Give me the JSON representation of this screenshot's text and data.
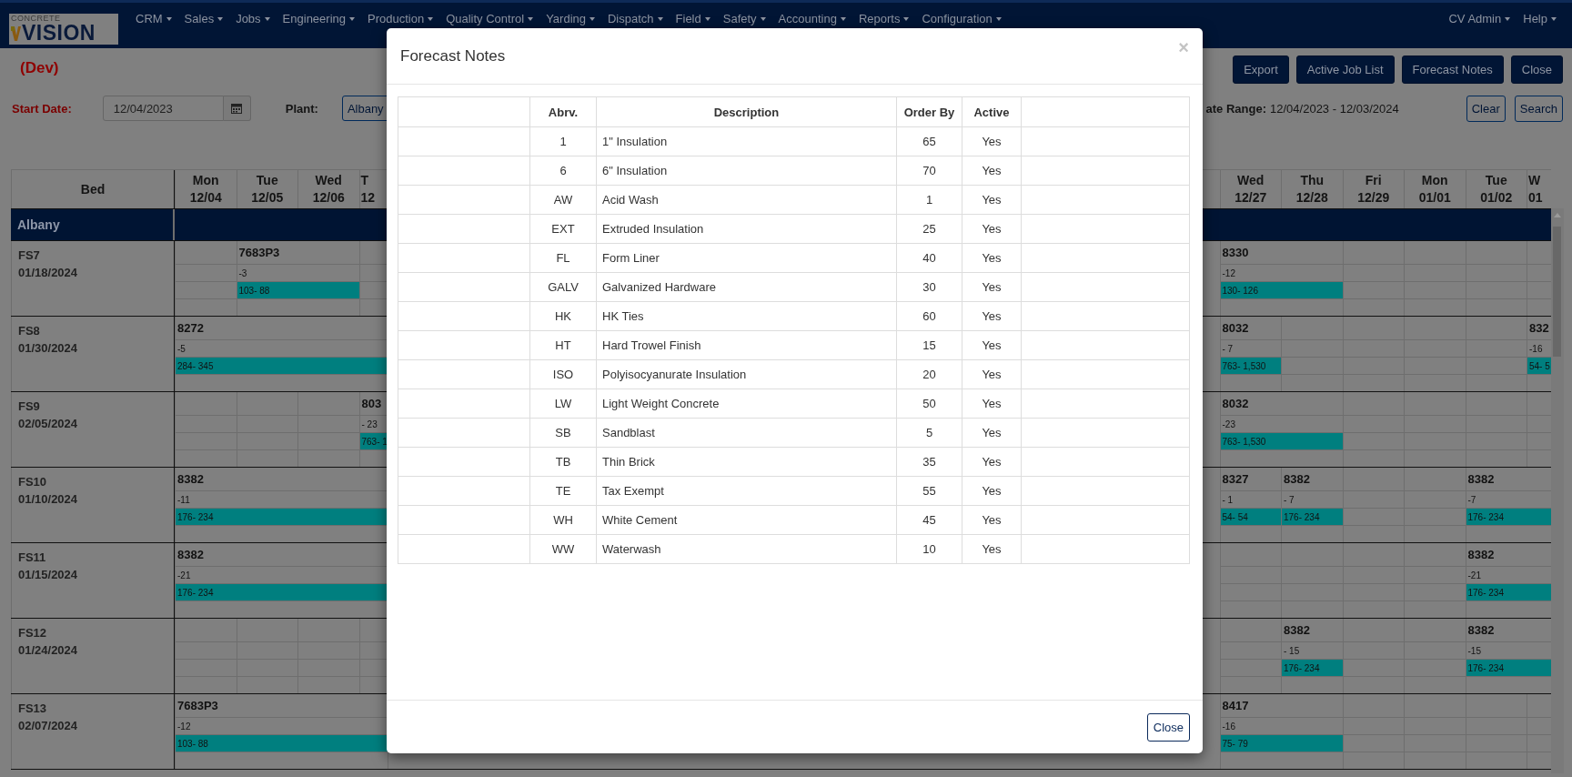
{
  "nav": {
    "logo": {
      "top": "CONCRETE",
      "main": "VISION"
    },
    "menu": [
      {
        "label": "CRM"
      },
      {
        "label": "Sales"
      },
      {
        "label": "Jobs"
      },
      {
        "label": "Engineering"
      },
      {
        "label": "Production"
      },
      {
        "label": "Quality Control"
      },
      {
        "label": "Yarding"
      },
      {
        "label": "Dispatch"
      },
      {
        "label": "Field"
      },
      {
        "label": "Safety"
      },
      {
        "label": "Accounting"
      },
      {
        "label": "Reports"
      },
      {
        "label": "Configuration"
      }
    ],
    "user_menu": [
      {
        "label": "CV Admin"
      },
      {
        "label": "Help"
      }
    ]
  },
  "page": {
    "env_label": "(Dev)",
    "buttons": [
      "Export",
      "Active Job List",
      "Forecast Notes",
      "Close"
    ]
  },
  "filters": {
    "start_date": {
      "label": "Start Date:",
      "value": "12/04/2023"
    },
    "plant": {
      "label": "Plant:",
      "value": "Albany"
    },
    "date_range": {
      "label": "ate Range:",
      "value": "12/04/2023 - 12/03/2024"
    },
    "buttons": [
      "Clear",
      "Search"
    ]
  },
  "schedule": {
    "bed_header": "Bed",
    "columns_left": [
      {
        "day": "Mon",
        "date": "12/04"
      },
      {
        "day": "Tue",
        "date": "12/05"
      },
      {
        "day": "Wed",
        "date": "12/06"
      },
      {
        "day": "T",
        "date": "12"
      }
    ],
    "columns_right": [
      {
        "day": "Wed",
        "date": "12/27"
      },
      {
        "day": "Thu",
        "date": "12/28"
      },
      {
        "day": "Fri",
        "date": "12/29"
      },
      {
        "day": "Mon",
        "date": "01/01"
      },
      {
        "day": "Tue",
        "date": "01/02"
      },
      {
        "day": "W",
        "date": "01"
      }
    ],
    "group": "Albany",
    "beds": [
      {
        "name": "FS7",
        "date": "01/18/2024",
        "left": [
          {
            "kind": "empty"
          },
          {
            "kind": "start",
            "job": "7683P3",
            "count": "-3",
            "range": "103- 88"
          },
          {
            "kind": "continue"
          },
          {
            "kind": "empty"
          }
        ],
        "right": [
          {
            "kind": "start",
            "job": "8330",
            "count": "-12",
            "range": "130- 126"
          },
          {
            "kind": "continue"
          },
          {
            "kind": "empty"
          },
          {
            "kind": "empty"
          },
          {
            "kind": "empty"
          },
          {
            "kind": "empty"
          }
        ]
      },
      {
        "name": "FS8",
        "date": "01/30/2024",
        "left": [
          {
            "kind": "start",
            "job": "8272",
            "count": "-5",
            "range": "284- 345"
          },
          {
            "kind": "continue"
          },
          {
            "kind": "continue"
          },
          {
            "kind": "continue"
          }
        ],
        "right": [
          {
            "kind": "start",
            "job": "8032",
            "count": "- 7",
            "range": "763- 1,530"
          },
          {
            "kind": "empty"
          },
          {
            "kind": "empty"
          },
          {
            "kind": "empty"
          },
          {
            "kind": "empty"
          },
          {
            "kind": "start",
            "job": "832",
            "count": "-16",
            "range": "54- 5"
          }
        ]
      },
      {
        "name": "FS9",
        "date": "02/05/2024",
        "left": [
          {
            "kind": "empty"
          },
          {
            "kind": "empty"
          },
          {
            "kind": "empty"
          },
          {
            "kind": "start",
            "job": "803",
            "count": "- 23",
            "range": "763- 1"
          }
        ],
        "right": [
          {
            "kind": "start",
            "job": "8032",
            "count": "-23",
            "range": "763- 1,530"
          },
          {
            "kind": "continue"
          },
          {
            "kind": "empty"
          },
          {
            "kind": "empty"
          },
          {
            "kind": "empty"
          },
          {
            "kind": "empty"
          }
        ]
      },
      {
        "name": "FS10",
        "date": "01/10/2024",
        "left": [
          {
            "kind": "start",
            "job": "8382",
            "count": "-11",
            "range": "176- 234"
          },
          {
            "kind": "continue"
          },
          {
            "kind": "continue"
          },
          {
            "kind": "continue"
          }
        ],
        "right": [
          {
            "kind": "start",
            "job": "8327",
            "count": "- 1",
            "range": "54- 54"
          },
          {
            "kind": "start",
            "job": "8382",
            "count": "- 7",
            "range": "176- 234"
          },
          {
            "kind": "empty"
          },
          {
            "kind": "empty"
          },
          {
            "kind": "start",
            "job": "8382",
            "count": "-7",
            "range": "176- 234"
          },
          {
            "kind": "continue"
          }
        ]
      },
      {
        "name": "FS11",
        "date": "01/15/2024",
        "left": [
          {
            "kind": "start",
            "job": "8382",
            "count": "-21",
            "range": "176- 234"
          },
          {
            "kind": "continue"
          },
          {
            "kind": "continue"
          },
          {
            "kind": "continue"
          }
        ],
        "right": [
          {
            "kind": "empty"
          },
          {
            "kind": "empty"
          },
          {
            "kind": "empty"
          },
          {
            "kind": "empty"
          },
          {
            "kind": "start",
            "job": "8382",
            "count": "-21",
            "range": "176- 234"
          },
          {
            "kind": "continue"
          }
        ]
      },
      {
        "name": "FS12",
        "date": "01/24/2024",
        "left": [
          {
            "kind": "empty"
          },
          {
            "kind": "empty"
          },
          {
            "kind": "empty"
          },
          {
            "kind": "empty"
          }
        ],
        "right": [
          {
            "kind": "empty"
          },
          {
            "kind": "start",
            "job": "8382",
            "count": "- 15",
            "range": "176- 234"
          },
          {
            "kind": "empty"
          },
          {
            "kind": "empty"
          },
          {
            "kind": "start",
            "job": "8382",
            "count": "-15",
            "range": "176- 234"
          },
          {
            "kind": "continue"
          }
        ]
      },
      {
        "name": "FS13",
        "date": "02/07/2024",
        "left": [
          {
            "kind": "start",
            "job": "7683P3",
            "count": "-12",
            "range": "103- 88"
          },
          {
            "kind": "continue"
          },
          {
            "kind": "continue"
          },
          {
            "kind": "continue"
          }
        ],
        "right": [
          {
            "kind": "start",
            "job": "8417",
            "count": "-16",
            "range": "75- 79"
          },
          {
            "kind": "continue"
          },
          {
            "kind": "empty"
          },
          {
            "kind": "empty"
          },
          {
            "kind": "empty"
          },
          {
            "kind": "empty"
          }
        ]
      }
    ]
  },
  "modal": {
    "title": "Forecast Notes",
    "close_symbol": "×",
    "columns": [
      "Abrv.",
      "Description",
      "Order By",
      "Active"
    ],
    "rows": [
      {
        "abrv": "1",
        "description": "1\" Insulation",
        "order_by": "65",
        "active": "Yes"
      },
      {
        "abrv": "6",
        "description": "6\" Insulation",
        "order_by": "70",
        "active": "Yes"
      },
      {
        "abrv": "AW",
        "description": "Acid Wash",
        "order_by": "1",
        "active": "Yes"
      },
      {
        "abrv": "EXT",
        "description": "Extruded Insulation",
        "order_by": "25",
        "active": "Yes"
      },
      {
        "abrv": "FL",
        "description": "Form Liner",
        "order_by": "40",
        "active": "Yes"
      },
      {
        "abrv": "GALV",
        "description": "Galvanized Hardware",
        "order_by": "30",
        "active": "Yes"
      },
      {
        "abrv": "HK",
        "description": "HK Ties",
        "order_by": "60",
        "active": "Yes"
      },
      {
        "abrv": "HT",
        "description": "Hard Trowel Finish",
        "order_by": "15",
        "active": "Yes"
      },
      {
        "abrv": "ISO",
        "description": "Polyisocyanurate Insulation",
        "order_by": "20",
        "active": "Yes"
      },
      {
        "abrv": "LW",
        "description": "Light Weight Concrete",
        "order_by": "50",
        "active": "Yes"
      },
      {
        "abrv": "SB",
        "description": "Sandblast",
        "order_by": "5",
        "active": "Yes"
      },
      {
        "abrv": "TB",
        "description": "Thin Brick",
        "order_by": "35",
        "active": "Yes"
      },
      {
        "abrv": "TE",
        "description": "Tax Exempt",
        "order_by": "55",
        "active": "Yes"
      },
      {
        "abrv": "WH",
        "description": "White Cement",
        "order_by": "45",
        "active": "Yes"
      },
      {
        "abrv": "WW",
        "description": "Waterwash",
        "order_by": "10",
        "active": "Yes"
      }
    ],
    "footer_button": "Close"
  }
}
